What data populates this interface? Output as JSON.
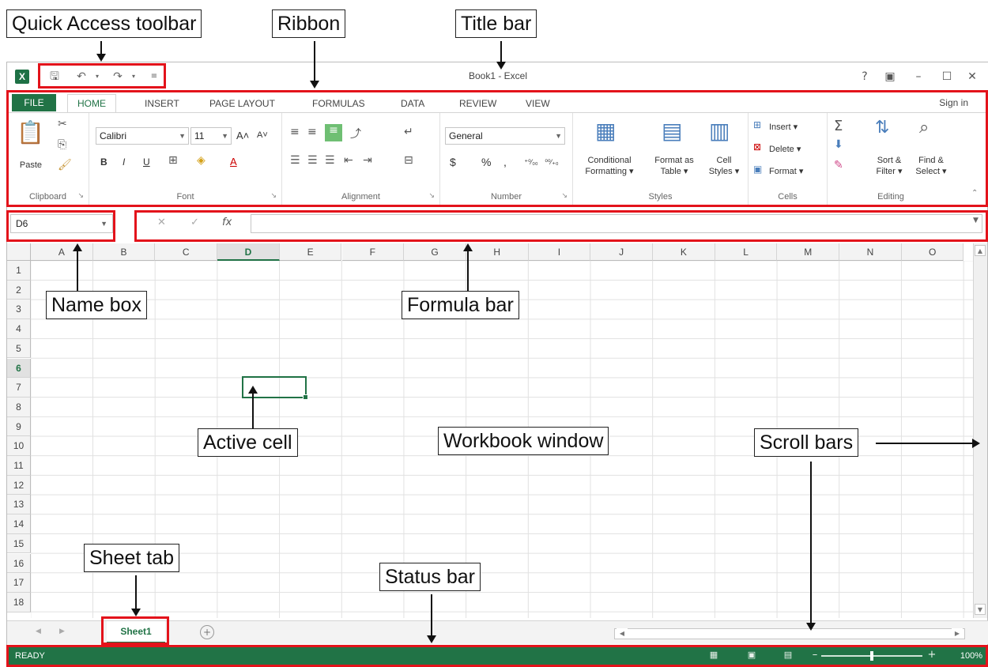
{
  "callouts": {
    "qat": "Quick Access toolbar",
    "ribbon": "Ribbon",
    "titlebar": "Title bar",
    "namebox": "Name box",
    "formulabar": "Formula bar",
    "activecell": "Active cell",
    "workbook": "Workbook window",
    "scrollbars": "Scroll bars",
    "sheettab": "Sheet tab",
    "statusbar": "Status bar"
  },
  "window": {
    "title": "Book1 - Excel",
    "app_icon": "X",
    "help": "?",
    "restore_ribbon": "▣",
    "minimize": "–",
    "maximize": "☐",
    "close": "✕"
  },
  "tabs": {
    "file": "FILE",
    "home": "HOME",
    "insert": "INSERT",
    "page_layout": "PAGE LAYOUT",
    "formulas": "FORMULAS",
    "data": "DATA",
    "review": "REVIEW",
    "view": "VIEW",
    "sign_in": "Sign in"
  },
  "ribbon": {
    "clipboard": {
      "label": "Clipboard",
      "paste": "Paste"
    },
    "font": {
      "label": "Font",
      "name": "Calibri",
      "size": "11",
      "bold": "B",
      "italic": "I",
      "underline": "U",
      "grow": "A˄",
      "shrink": "A˅",
      "font_color": "A"
    },
    "alignment": {
      "label": "Alignment"
    },
    "number": {
      "label": "Number",
      "format": "General",
      "currency": "$",
      "percent": "%",
      "comma": ",",
      "inc_dec": "⁺⁰⁄₀₀",
      "dec_dec": "⁰⁰⁄₊₀"
    },
    "styles": {
      "label": "Styles",
      "cond_fmt_1": "Conditional",
      "cond_fmt_2": "Formatting ▾",
      "fmt_table_1": "Format as",
      "fmt_table_2": "Table ▾",
      "cell_styles_1": "Cell",
      "cell_styles_2": "Styles ▾"
    },
    "cells": {
      "label": "Cells",
      "insert": "Insert ▾",
      "delete": "Delete ▾",
      "format": "Format ▾"
    },
    "editing": {
      "label": "Editing",
      "sort_1": "Sort &",
      "sort_2": "Filter ▾",
      "find_1": "Find &",
      "find_2": "Select ▾"
    }
  },
  "formula_bar": {
    "name_box": "D6",
    "cancel": "✕",
    "enter": "✓",
    "fx": "fx",
    "value": ""
  },
  "grid": {
    "columns": [
      "A",
      "B",
      "C",
      "D",
      "E",
      "F",
      "G",
      "H",
      "I",
      "J",
      "K",
      "L",
      "M",
      "N",
      "O"
    ],
    "rows": [
      "1",
      "2",
      "3",
      "4",
      "5",
      "6",
      "7",
      "8",
      "9",
      "10",
      "11",
      "12",
      "13",
      "14",
      "15",
      "16",
      "17",
      "18"
    ],
    "selected_column": "D",
    "selected_row": "6"
  },
  "sheets": {
    "tabs": [
      "Sheet1"
    ],
    "add": "+"
  },
  "status": {
    "mode": "READY",
    "zoom": "100%",
    "zoom_level": 0.5
  }
}
